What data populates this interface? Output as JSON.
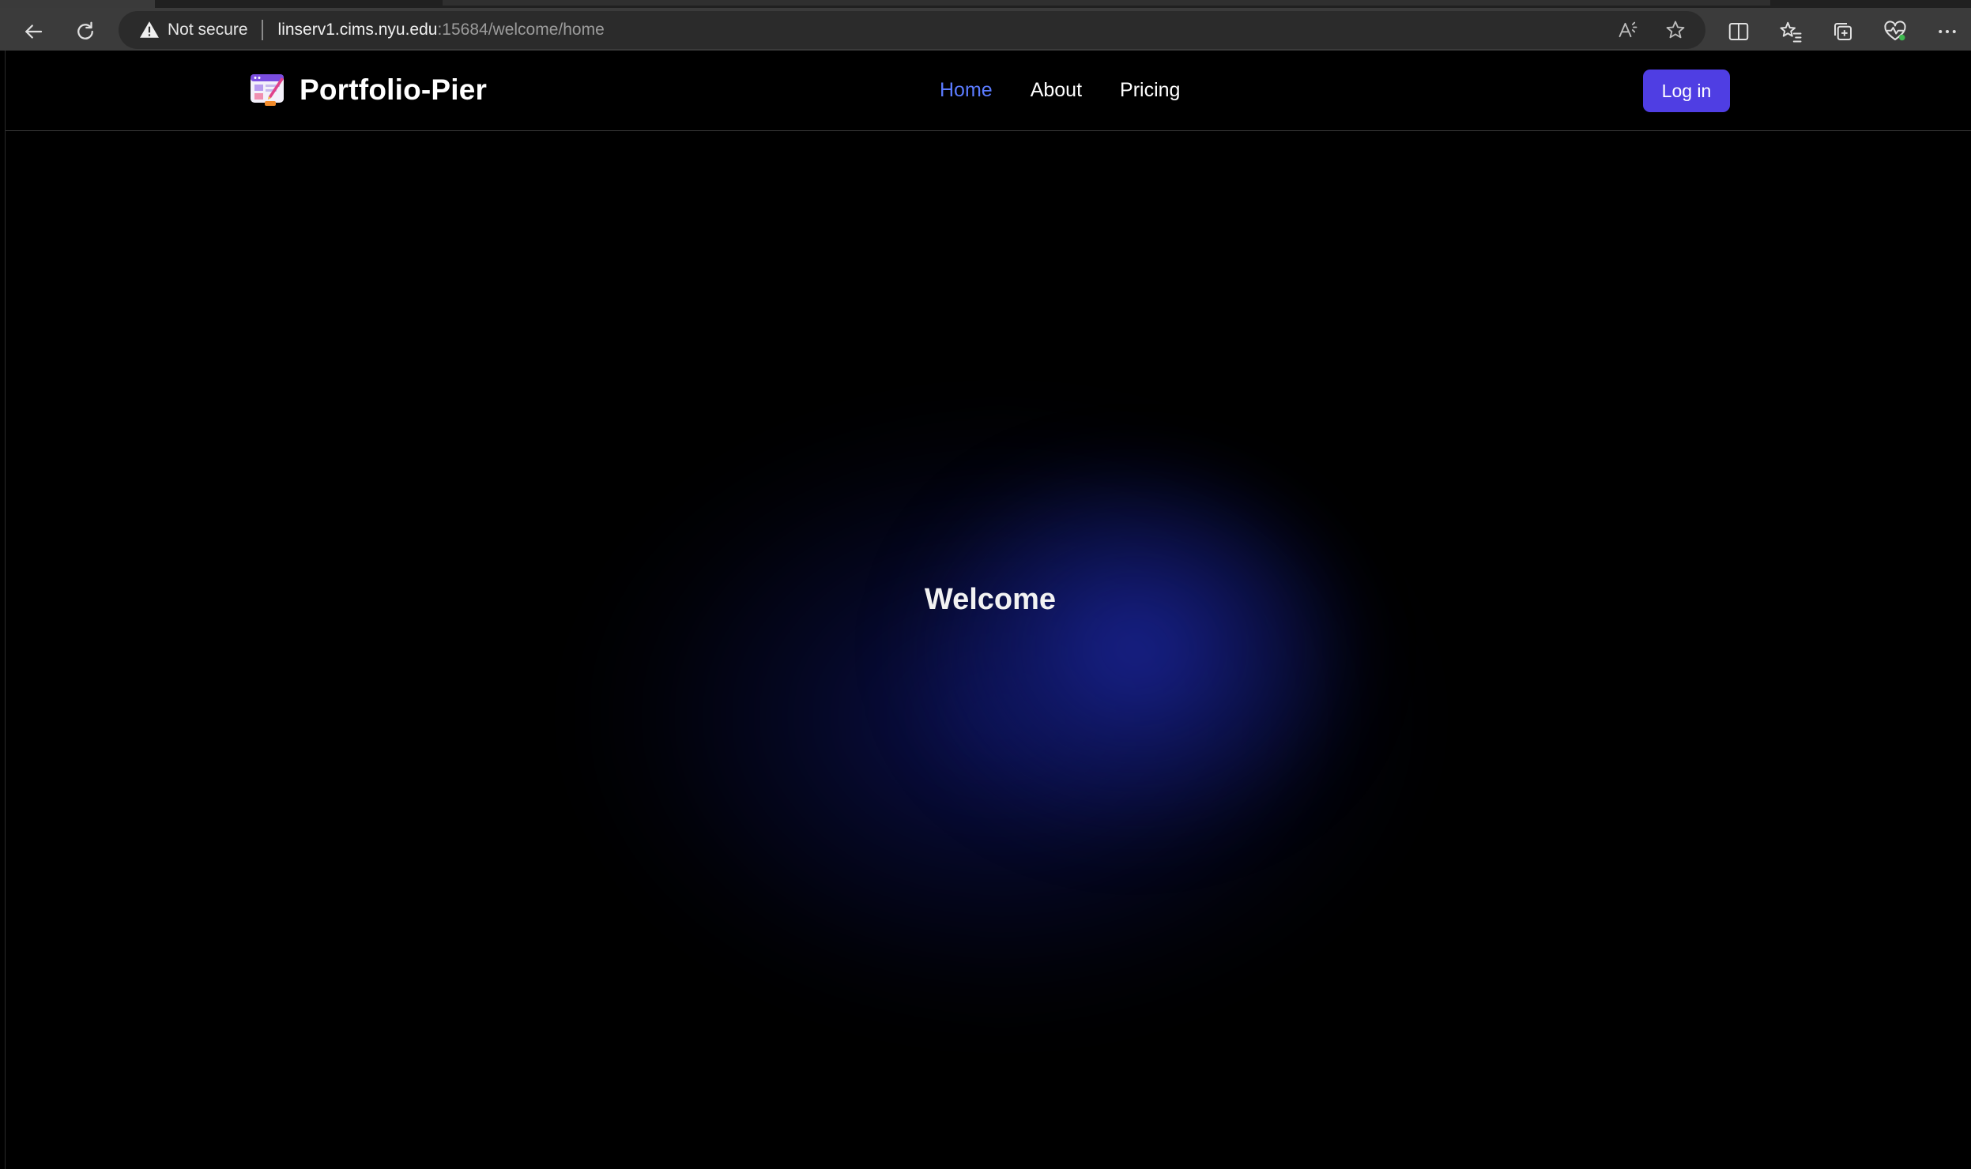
{
  "browser": {
    "security_label": "Not secure",
    "url_host": "linserv1.cims.nyu.edu",
    "url_rest": ":15684/welcome/home"
  },
  "site": {
    "brand_name": "Portfolio-Pier",
    "nav": [
      {
        "label": "Home",
        "active": true
      },
      {
        "label": "About",
        "active": false
      },
      {
        "label": "Pricing",
        "active": false
      }
    ],
    "login_label": "Log in"
  },
  "hero": {
    "title": "Welcome"
  },
  "colors": {
    "accent": "#4f3ee3",
    "nav_active": "#5b7bff",
    "background": "#000000",
    "glow": "#1a2496"
  }
}
